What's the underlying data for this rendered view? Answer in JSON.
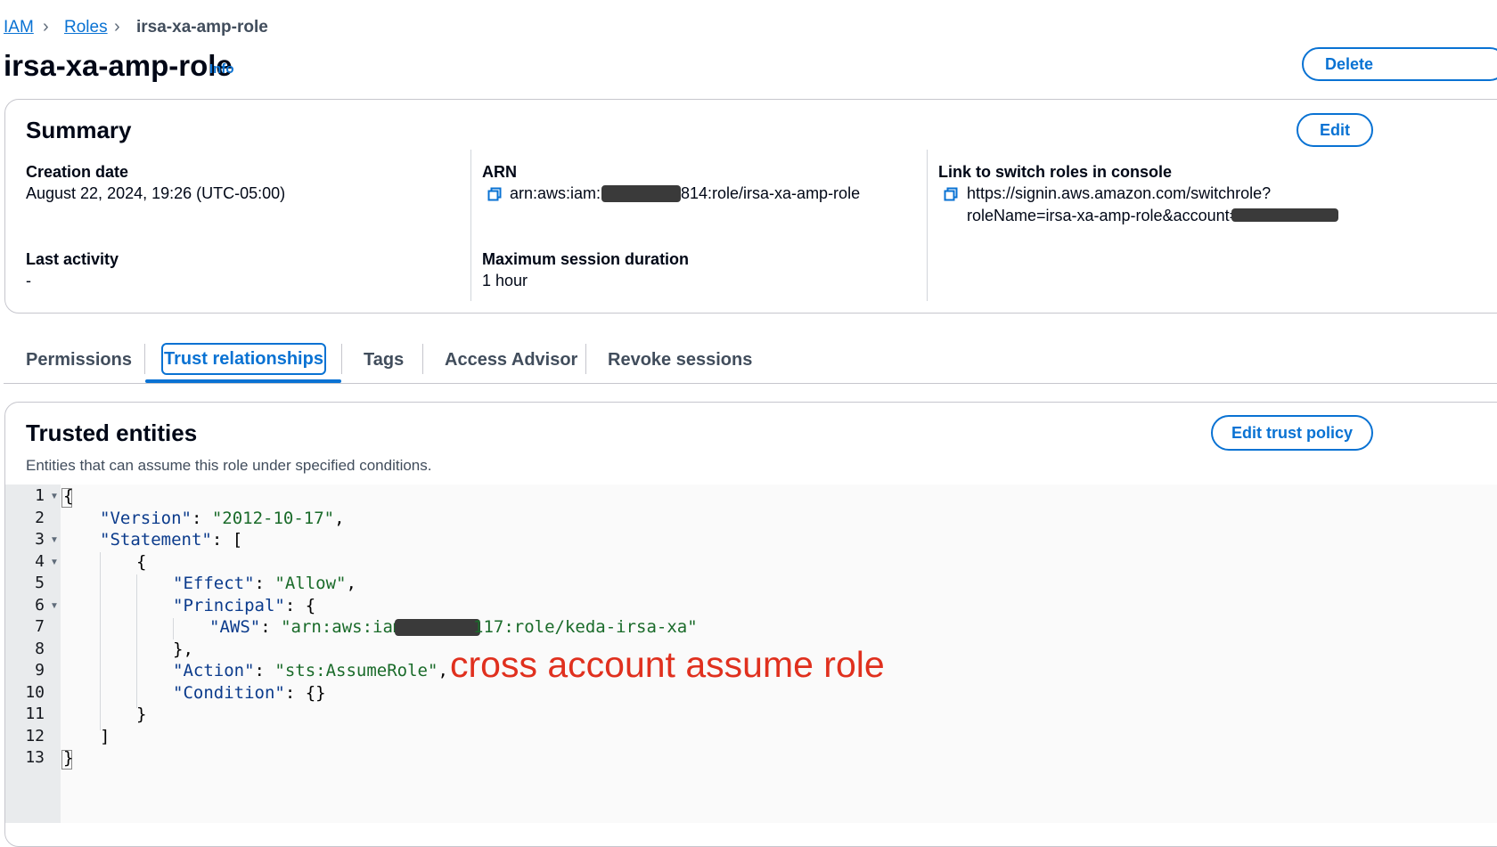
{
  "breadcrumb": {
    "iam": "IAM",
    "roles": "Roles",
    "current": "irsa-xa-amp-role"
  },
  "header": {
    "title": "irsa-xa-amp-role",
    "info": "Info",
    "delete_label": "Delete"
  },
  "summary": {
    "title": "Summary",
    "edit_label": "Edit",
    "creation_date_label": "Creation date",
    "creation_date_value": "August 22, 2024, 19:26 (UTC-05:00)",
    "last_activity_label": "Last activity",
    "last_activity_value": "-",
    "arn_label": "ARN",
    "arn_prefix": "arn:aws:iam::",
    "arn_suffix": "814:role/irsa-xa-amp-role",
    "max_session_label": "Maximum session duration",
    "max_session_value": "1 hour",
    "switch_link_label": "Link to switch roles in console",
    "switch_link_line1": "https://signin.aws.amazon.com/switchrole?",
    "switch_link_line2": "roleName=irsa-xa-amp-role&account="
  },
  "tabs": [
    {
      "label": "Permissions"
    },
    {
      "label": "Trust relationships",
      "active": true
    },
    {
      "label": "Tags"
    },
    {
      "label": "Access Advisor"
    },
    {
      "label": "Revoke sessions"
    }
  ],
  "trusted": {
    "title": "Trusted entities",
    "description": "Entities that can assume this role under specified conditions.",
    "edit_label": "Edit trust policy"
  },
  "code": {
    "line_numbers": [
      "1",
      "2",
      "3",
      "4",
      "5",
      "6",
      "7",
      "8",
      "9",
      "10",
      "11",
      "12",
      "13"
    ],
    "l1": "{",
    "l2_key": "\"Version\"",
    "l2_val": "\"2012-10-17\"",
    "l3_key": "\"Statement\"",
    "l4": "{",
    "l5_key": "\"Effect\"",
    "l5_val": "\"Allow\"",
    "l6_key": "\"Principal\"",
    "l7_key": "\"AWS\"",
    "l7_val_prefix": "\"arn:aws:iam:",
    "l7_val_suffix": "117:role/keda-irsa-xa\"",
    "l8": "},",
    "l9_key": "\"Action\"",
    "l9_val": "\"sts:AssumeRole\"",
    "l10_key": "\"Condition\"",
    "l11": "}",
    "l12": "]",
    "l13": "}"
  },
  "annotation": "cross account assume role",
  "colors": {
    "accent": "#0972d3",
    "annotation": "#e0301e"
  }
}
